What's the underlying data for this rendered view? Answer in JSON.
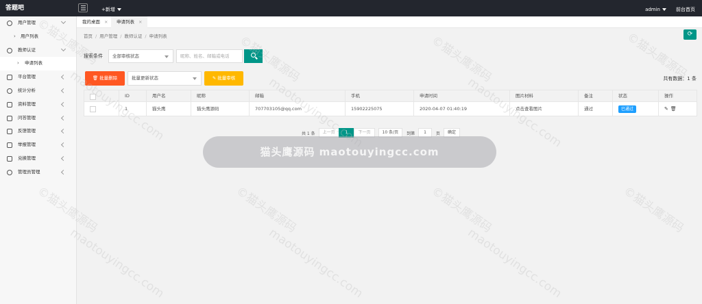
{
  "app": {
    "title": "答题吧"
  },
  "topbar": {
    "new_label": "+新增",
    "user": "admin",
    "front_home": "前台首页"
  },
  "sidebar": {
    "items": [
      {
        "label": "用户管理",
        "expanded": true
      },
      {
        "label": "用户列表"
      },
      {
        "label": "教师认证",
        "expanded": true
      },
      {
        "label": "申请列表"
      },
      {
        "label": "平台管理"
      },
      {
        "label": "统计分析"
      },
      {
        "label": "资料管理"
      },
      {
        "label": "问答管理"
      },
      {
        "label": "反馈管理"
      },
      {
        "label": "举报管理"
      },
      {
        "label": "兑换管理"
      },
      {
        "label": "管理员管理"
      }
    ]
  },
  "tabs": [
    {
      "label": "我的桌面",
      "active": false
    },
    {
      "label": "申请列表",
      "active": true
    }
  ],
  "breadcrumb": [
    "首页",
    "用户管理",
    "教师认证",
    "申请列表"
  ],
  "search": {
    "label": "搜索条件",
    "status_select": "全部审核状态",
    "placeholder": "昵称、姓名、邮箱或电话"
  },
  "toolbar": {
    "batch_delete": "批量删除",
    "batch_status_select": "批量更新状态",
    "batch_review": "批量审核",
    "total_text": "共有数据：1 条"
  },
  "table": {
    "columns": [
      "ID",
      "用户名",
      "昵称",
      "邮箱",
      "手机",
      "申请时间",
      "图片材料",
      "备注",
      "状态",
      "操作"
    ],
    "rows": [
      {
        "id": "1",
        "username": "猫头鹰",
        "nickname": "猫头鹰源码",
        "email": "707703105@qq.com",
        "phone": "15902225075",
        "apply_time": "2020-04-07 01:40:19",
        "image": "点击查看图片",
        "remark": "通过",
        "status": "已通过"
      }
    ]
  },
  "pager": {
    "total": "共 1 条",
    "prev": "上一页",
    "current": "1",
    "next": "下一页",
    "page_size": "10 条/页",
    "goto_label": "到第",
    "goto_value": "1",
    "page_unit": "页",
    "confirm": "确定"
  },
  "watermark": {
    "banner": "猫头鹰源码 maotouyingcc.com",
    "cn": "©猫头鹰源码",
    "en": "maotouyingcc.com"
  },
  "colors": {
    "topbar": "#23262e",
    "primary": "#009688",
    "danger": "#ff5722",
    "warn": "#ffb800",
    "badge": "#1e9fff"
  }
}
